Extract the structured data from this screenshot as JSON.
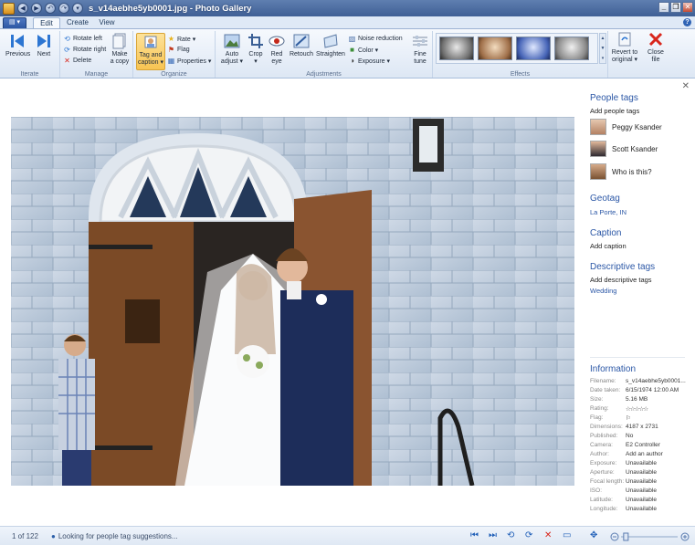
{
  "window": {
    "title": "s_v14aebhe5yb0001.jpg - Photo Gallery"
  },
  "tabs": [
    {
      "label": "Edit",
      "active": true
    },
    {
      "label": "Create",
      "active": false
    },
    {
      "label": "View",
      "active": false
    }
  ],
  "ribbon": {
    "iterate": {
      "label": "Iterate",
      "previous": "Previous",
      "next": "Next"
    },
    "manage": {
      "label": "Manage",
      "rotate_left": "Rotate left",
      "rotate_right": "Rotate right",
      "delete": "Delete",
      "make_copy_1": "Make",
      "make_copy_2": "a copy"
    },
    "organize": {
      "label": "Organize",
      "tag_caption_1": "Tag and",
      "tag_caption_2": "caption ▾",
      "rate": "Rate ▾",
      "flag": "Flag",
      "properties": "Properties ▾"
    },
    "adjustments": {
      "label": "Adjustments",
      "auto_adjust_1": "Auto",
      "auto_adjust_2": "adjust ▾",
      "crop_1": "Crop",
      "crop_2": "▾",
      "red_eye_1": "Red",
      "red_eye_2": "eye",
      "retouch": "Retouch",
      "straighten": "Straighten",
      "noise_reduction": "Noise reduction",
      "color": "Color ▾",
      "exposure": "Exposure ▾",
      "fine_tune_1": "Fine",
      "fine_tune_2": "tune"
    },
    "effects": {
      "label": "Effects"
    },
    "revert_1": "Revert to",
    "revert_2": "original ▾",
    "close_1": "Close",
    "close_2": "file"
  },
  "side": {
    "people_tags": {
      "heading": "People tags",
      "add": "Add people tags",
      "people": [
        "Peggy Ksander",
        "Scott Ksander",
        "Who is this?"
      ]
    },
    "geotag": {
      "heading": "Geotag",
      "value": "La Porte, IN"
    },
    "caption": {
      "heading": "Caption",
      "add": "Add caption"
    },
    "descriptive_tags": {
      "heading": "Descriptive tags",
      "add": "Add descriptive tags",
      "tags": [
        "Wedding"
      ]
    },
    "information": {
      "heading": "Information",
      "rows": [
        {
          "k": "Filename:",
          "v": "s_v14aebhe5yb0001..."
        },
        {
          "k": "Date taken:",
          "v": "6/15/1974  12:00 AM"
        },
        {
          "k": "Size:",
          "v": "5.16 MB"
        },
        {
          "k": "Rating:",
          "v": "☆☆☆☆☆"
        },
        {
          "k": "Flag:",
          "v": "⚐"
        },
        {
          "k": "Dimensions:",
          "v": "4187 x 2731"
        },
        {
          "k": "Published:",
          "v": "No"
        },
        {
          "k": "Camera:",
          "v": "E2 Controller"
        },
        {
          "k": "Author:",
          "v": "Add an author"
        },
        {
          "k": "Exposure:",
          "v": "Unavailable"
        },
        {
          "k": "Aperture:",
          "v": "Unavailable"
        },
        {
          "k": "Focal length:",
          "v": "Unavailable"
        },
        {
          "k": "ISO:",
          "v": "Unavailable"
        },
        {
          "k": "Latitude:",
          "v": "Unavailable"
        },
        {
          "k": "Longitude:",
          "v": "Unavailable"
        }
      ]
    }
  },
  "status": {
    "count": "1 of 122",
    "message": "Looking for people tag suggestions...",
    "zoom_fraction": 0.05
  }
}
